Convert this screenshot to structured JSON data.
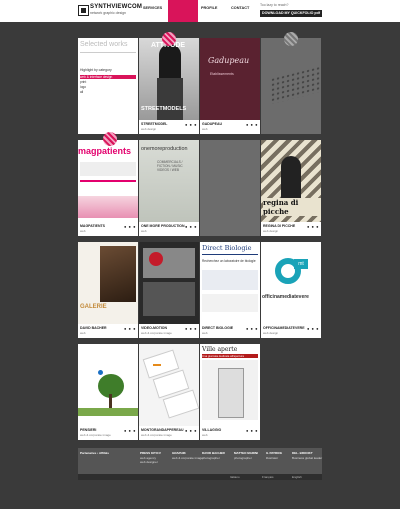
{
  "header": {
    "logo_name": "SYNTHVIEWCOM",
    "logo_tag": "network graphic design",
    "nav": [
      {
        "label": "SERVICES",
        "active": false
      },
      {
        "label": "",
        "active": true
      },
      {
        "label": "PROFILE",
        "active": false
      },
      {
        "label": "CONTACT",
        "active": false
      }
    ],
    "hire_text": "Too lazy to reach?",
    "download_label": "DOWNLOAD MY QUICKFOLIO pdf"
  },
  "sidebar_card": {
    "title": "Selected works",
    "subtitle": "Highlight by category",
    "categories": [
      "web & interface design",
      "print",
      "logo",
      "all"
    ]
  },
  "cards": [
    {
      "caption": "STREETMODEL",
      "sub": "web design",
      "thumb_text": "ATTITUDE",
      "thumb_sub": "STREETMODELS"
    },
    {
      "caption": "GADUPEAU",
      "sub": "web",
      "thumb_text": "Gadupeau",
      "thumb_sub": "Etablissements"
    },
    {
      "caption": "",
      "sub": "",
      "thumb_text": "",
      "thumb_sub": ""
    },
    {
      "caption": "MAGPATIENTS",
      "sub": "web",
      "thumb_text": "magpatients",
      "thumb_sub": ""
    },
    {
      "caption": "ONE MORE PRODUCTION",
      "sub": "web",
      "thumb_text": "onemoreproduction",
      "thumb_sub": "COMMERCIALS / FICTION / MUSIC VIDEOS / WEB"
    },
    {
      "caption": "",
      "sub": "",
      "thumb_text": "",
      "thumb_sub": ""
    },
    {
      "caption": "REGINA DI PICCHE",
      "sub": "web design",
      "thumb_text": "regina di picche",
      "thumb_sub": ""
    },
    {
      "caption": "DAVID BACHER",
      "sub": "web",
      "thumb_text": "GALERIE",
      "thumb_sub": ""
    },
    {
      "caption": "VIDEO-MOTION",
      "sub": "web & corporate image",
      "thumb_text": "",
      "thumb_sub": ""
    },
    {
      "caption": "DIRECT BIOLOGIE",
      "sub": "web",
      "thumb_text": "Direct Biologie",
      "thumb_sub": "Recherchez un laboratoire de biologie"
    },
    {
      "caption": "OFFICINAMEDIATEVERE",
      "sub": "web design",
      "thumb_text": "officinamediatevere",
      "thumb_sub": "mt"
    },
    {
      "caption": "PENSIERI",
      "sub": "web & corporate image",
      "thumb_text": "",
      "thumb_sub": ""
    },
    {
      "caption": "MONTGRANDAPPEREAU",
      "sub": "web & corporate image",
      "thumb_text": "",
      "thumb_sub": ""
    },
    {
      "caption": "VILLAGGIO",
      "sub": "web",
      "thumb_text": "Ville aperte",
      "thumb_sub": "Una giornata dedicata all'apertura"
    }
  ],
  "footer": {
    "cols": [
      {
        "head": "Partenaires • Affiliés",
        "lines": []
      },
      {
        "head": "PRESS KIT/CV",
        "lines": [
          "web agency",
          "web designer"
        ]
      },
      {
        "head": "GRAPHIK",
        "lines": [
          "web & corporate image"
        ]
      },
      {
        "head": "DAVID BACHER",
        "lines": [
          "photographer"
        ]
      },
      {
        "head": "MATTEO MARINI",
        "lines": [
          "photographer"
        ]
      },
      {
        "head": "IL PATRICE",
        "lines": [
          "illustrator"
        ]
      },
      {
        "head": "DEL. BROOKT",
        "lines": [
          "Business global leader"
        ]
      }
    ],
    "bottom": [
      "Italiano",
      "Français",
      "English"
    ]
  },
  "colors": {
    "accent": "#d9145a",
    "background": "#3a3a3a"
  }
}
